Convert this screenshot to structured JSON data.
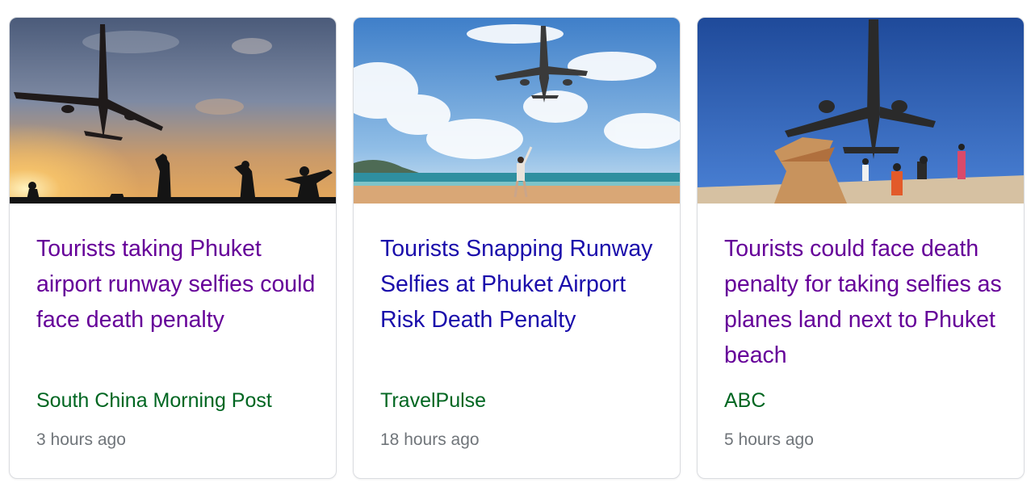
{
  "cards": [
    {
      "image_icon": "airplane-sunset-photo",
      "title": "Tourists taking Phuket airport runway selfies could face death penalty",
      "source": "South China Morning Post",
      "time": "3 hours ago",
      "title_color": "#660099"
    },
    {
      "image_icon": "airplane-beach-photo",
      "title": "Tourists Snapping Runway Selfies at Phuket Airport Risk Death Penalty",
      "source": "TravelPulse",
      "time": "18 hours ago",
      "title_color": "#1a0dab"
    },
    {
      "image_icon": "airplane-overhead-photo",
      "title": "Tourists could face death penalty for taking selfies as planes land next to Phuket beach",
      "source": "ABC",
      "time": "5 hours ago",
      "title_color": "#660099"
    }
  ],
  "colors": {
    "visited_link": "#660099",
    "link": "#1a0dab",
    "source": "#006621",
    "timestamp": "#70757a",
    "card_border": "#dadce0"
  }
}
